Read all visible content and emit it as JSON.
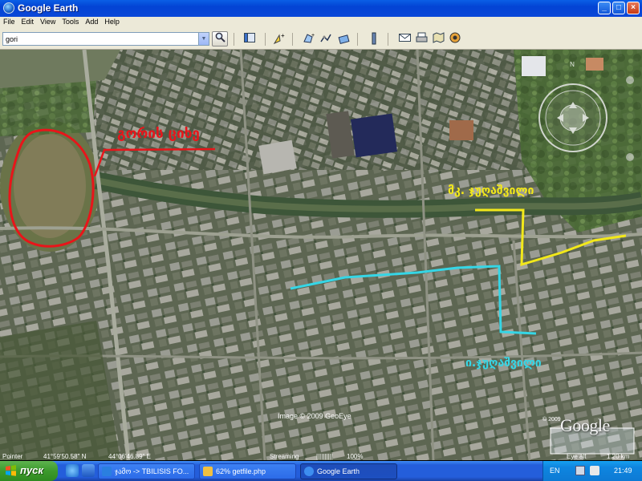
{
  "window": {
    "title": "Google Earth",
    "minimize": "_",
    "maximize": "□",
    "close": "×"
  },
  "menu": [
    "File",
    "Edit",
    "View",
    "Tools",
    "Add",
    "Help"
  ],
  "search": {
    "value": "gori"
  },
  "map": {
    "labels": {
      "red": "გორის ციხე",
      "yellow": "მკ. ჯუღაშვილი",
      "cyan": "ი.ჯუღაშვილი"
    },
    "imagery_credit": "Image © 2009 GeoEye",
    "logo": "Google",
    "logo_year": "© 2009",
    "eye_alt_label": "Eye alt",
    "eye_alt_value": "1.20 km",
    "colors": {
      "red": "#e8151a",
      "yellow": "#f2e81a",
      "cyan": "#35d6e6"
    }
  },
  "status": {
    "pointer_label": "Pointer",
    "lat": "41°59'50.58\" N",
    "lon": "44°06'46.89\" E",
    "streaming_label": "Streaming",
    "streaming_bar": "||||||||||",
    "streaming_pct": "100%"
  },
  "taskbar": {
    "start": "пуск",
    "tasks": [
      {
        "label": "ჯამო -> TBILISIS FO...",
        "icon_color": "#2a7fe0"
      },
      {
        "label": "62% getfile.php",
        "icon_color": "#f0c040"
      },
      {
        "label": "Google Earth",
        "icon_color": "#3d8ef0",
        "active": true
      }
    ],
    "lang": "EN",
    "clock": "21:49"
  }
}
